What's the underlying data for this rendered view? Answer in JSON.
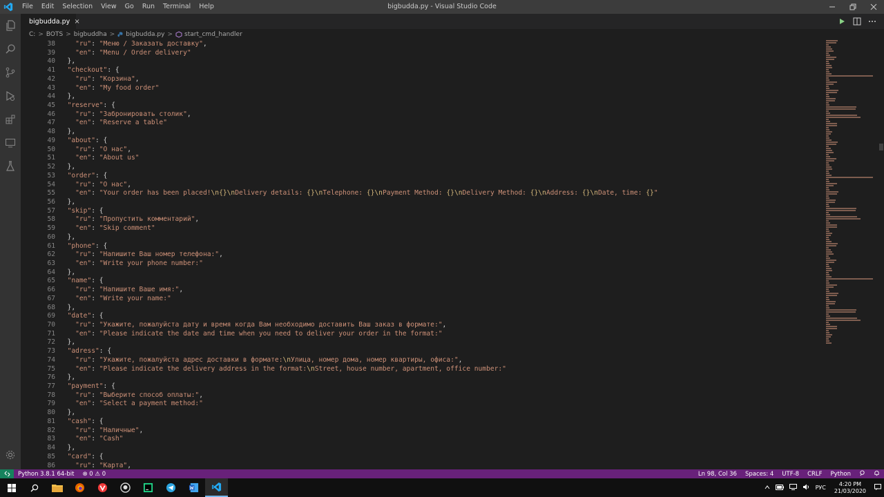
{
  "window": {
    "title": "bigbudda.py - Visual Studio Code"
  },
  "menu": [
    "File",
    "Edit",
    "Selection",
    "View",
    "Go",
    "Run",
    "Terminal",
    "Help"
  ],
  "tab": {
    "label": "bigbudda.py",
    "close": "×"
  },
  "breadcrumb": {
    "items": [
      "C:",
      "BOTS",
      "bigbuddha",
      "bigbudda.py",
      "start_cmd_handler"
    ],
    "separator": ">"
  },
  "editor": {
    "line_numbers": [
      "38",
      "39",
      "40",
      "41",
      "42",
      "43",
      "44",
      "45",
      "46",
      "47",
      "48",
      "49",
      "50",
      "51",
      "52",
      "53",
      "54",
      "55",
      "56",
      "57",
      "58",
      "59",
      "60",
      "61",
      "62",
      "63",
      "64",
      "65",
      "66",
      "67",
      "68",
      "69",
      "70",
      "71",
      "72",
      "73",
      "74",
      "75",
      "76",
      "77",
      "78",
      "79",
      "80",
      "81",
      "82",
      "83",
      "84",
      "85",
      "86"
    ],
    "lines": [
      "    \"ru\": \"Меню / Заказать доставку\",",
      "    \"en\": \"Menu / Order delivery\"",
      "  },",
      "  \"checkout\": {",
      "    \"ru\": \"Корзина\",",
      "    \"en\": \"My food order\"",
      "  },",
      "  \"reserve\": {",
      "    \"ru\": \"Забронировать столик\",",
      "    \"en\": \"Reserve a table\"",
      "  },",
      "  \"about\": {",
      "    \"ru\": \"О нас\",",
      "    \"en\": \"About us\"",
      "  },",
      "  \"order\": {",
      "    \"ru\": \"О нас\",",
      "    \"en\": \"Your order has been placed!\\n{}\\nDelivery details: {}\\nTelephone: {}\\nPayment Method: {}\\nDelivery Method: {}\\nAddress: {}\\nDate, time: {}\"",
      "  },",
      "  \"skip\": {",
      "    \"ru\": \"Пропустить комментарий\",",
      "    \"en\": \"Skip comment\"",
      "  },",
      "  \"phone\": {",
      "    \"ru\": \"Напишите Ваш номер телефона:\",",
      "    \"en\": \"Write your phone number:\"",
      "  },",
      "  \"name\": {",
      "    \"ru\": \"Напишите Ваше имя:\",",
      "    \"en\": \"Write your name:\"",
      "  },",
      "  \"date\": {",
      "    \"ru\": \"Укажите, пожалуйста дату и время когда Вам необходимо доставить Ваш заказ в формате:\",",
      "    \"en\": \"Please indicate the date and time when you need to deliver your order in the format:\"",
      "  },",
      "  \"adress\": {",
      "    \"ru\": \"Укажите, пожалуйста адрес доставки в формате:\\nУлица, номер дома, номер квартиры, офиса:\",",
      "    \"en\": \"Please indicate the delivery address in the format:\\nStreet, house number, apartment, office number:\"",
      "  },",
      "  \"payment\": {",
      "    \"ru\": \"Выберите способ оплаты:\",",
      "    \"en\": \"Select a payment method:\"",
      "  },",
      "  \"cash\": {",
      "    \"ru\": \"Наличные\",",
      "    \"en\": \"Cash\"",
      "  },",
      "  \"card\": {",
      "    \"ru\": \"Карта\","
    ]
  },
  "statusbar": {
    "python": "Python 3.8.1 64-bit",
    "errors": "⊗ 0",
    "warnings": "⚠ 0",
    "position": "Ln 98, Col 36",
    "spaces": "Spaces: 4",
    "encoding": "UTF-8",
    "eol": "CRLF",
    "language": "Python"
  },
  "taskbar": {
    "lang": "РУС",
    "time": "4:20 PM",
    "date": "21/03/2020"
  },
  "colors": {
    "accent_status": "#68217a",
    "remote": "#16825d",
    "string": "#ce9178",
    "punct": "#d4d4d4",
    "escape": "#d7ba7d"
  }
}
